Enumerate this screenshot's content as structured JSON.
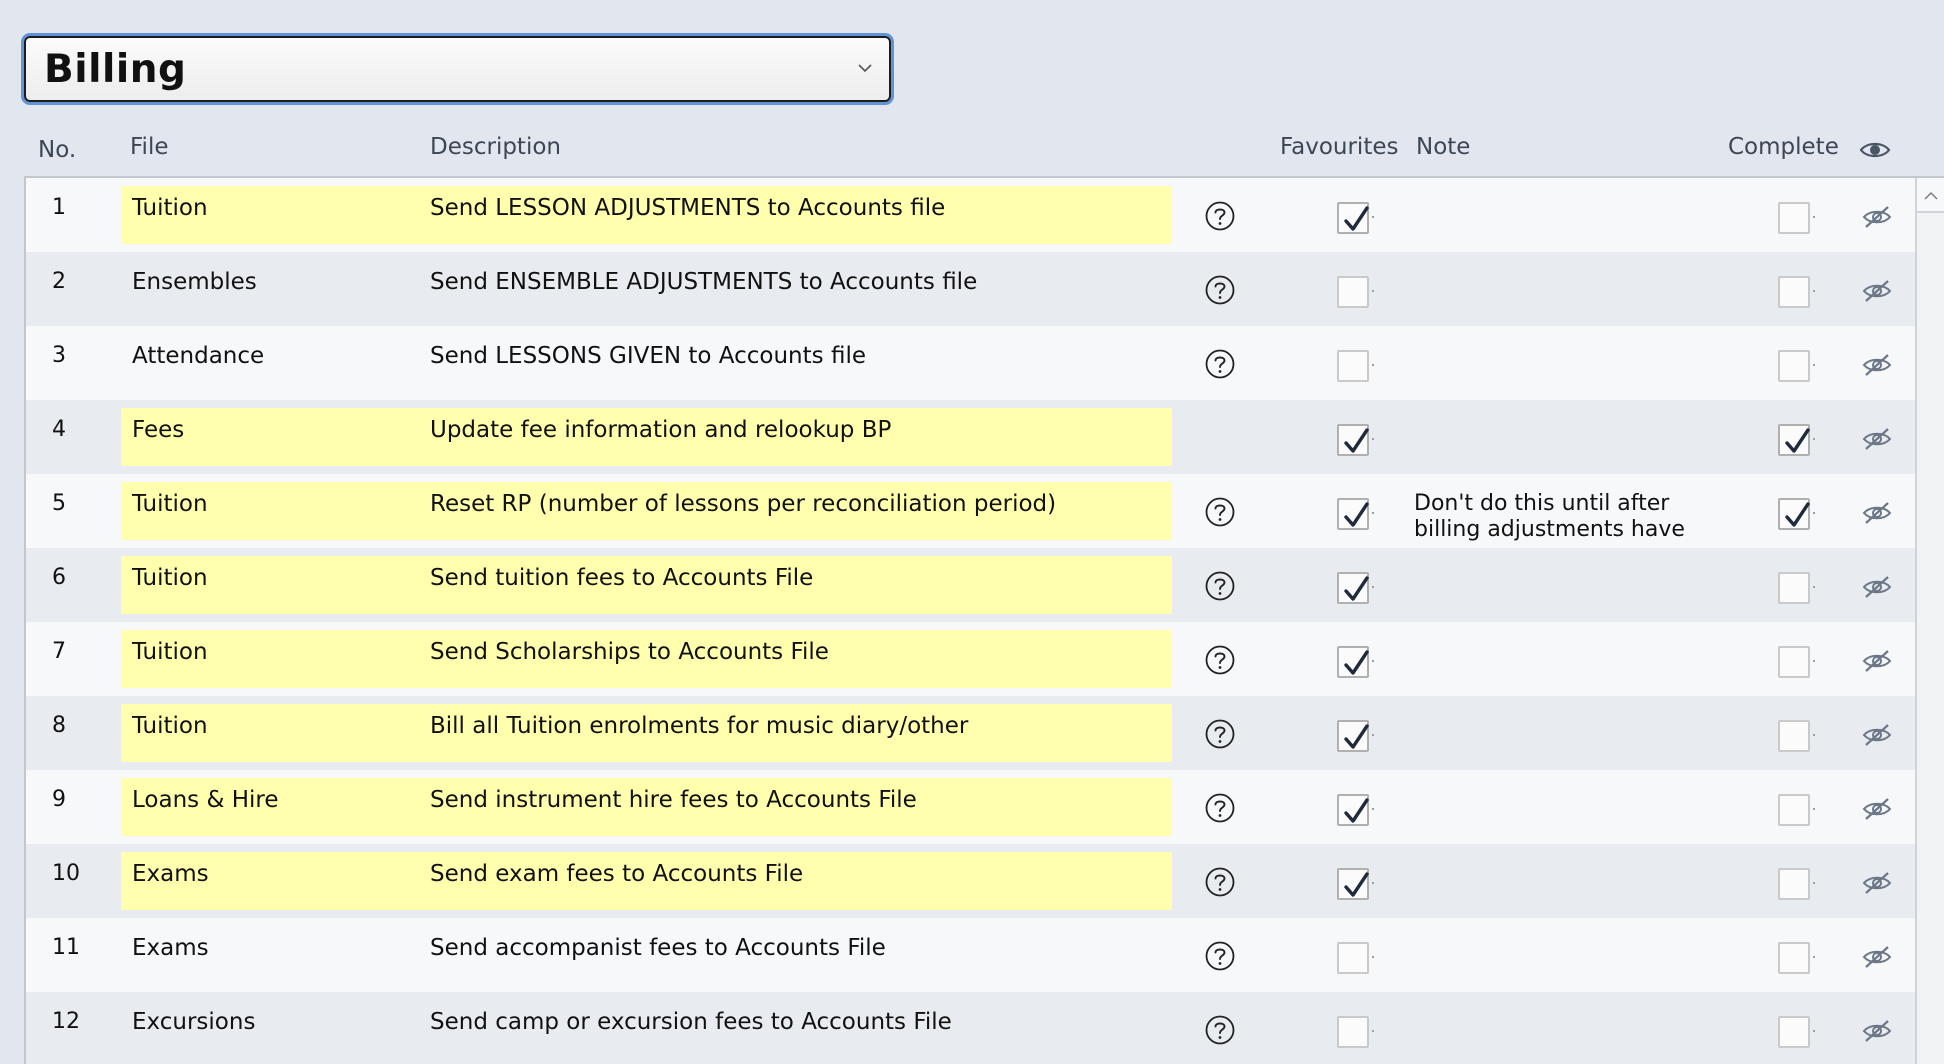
{
  "category_select": {
    "value": "Billing"
  },
  "columns": {
    "no": "No.",
    "file": "File",
    "description": "Description",
    "favourites": "Favourites",
    "note": "Note",
    "complete": "Complete"
  },
  "icons": {
    "dropdown": "chevron-down-icon",
    "help": "question-circle-icon",
    "visibility_header": "eye-icon",
    "row_visibility": "eye-slash-icon",
    "check": "checkmark-icon",
    "scroll_up": "caret-up-icon"
  },
  "colors": {
    "highlight": "#ffffad",
    "focus_ring": "#5f95d6",
    "check": "#1f2a3c"
  },
  "rows": [
    {
      "no": "1",
      "file": "Tuition",
      "description": "Send LESSON ADJUSTMENTS to Accounts file",
      "highlighted": true,
      "help": true,
      "favourite": true,
      "note": "",
      "complete": false
    },
    {
      "no": "2",
      "file": "Ensembles",
      "description": "Send ENSEMBLE ADJUSTMENTS to Accounts file",
      "highlighted": false,
      "help": true,
      "favourite": false,
      "note": "",
      "complete": false
    },
    {
      "no": "3",
      "file": "Attendance",
      "description": "Send LESSONS GIVEN to Accounts file",
      "highlighted": false,
      "help": true,
      "favourite": false,
      "note": "",
      "complete": false
    },
    {
      "no": "4",
      "file": "Fees",
      "description": "Update fee information and relookup BP",
      "highlighted": true,
      "help": false,
      "favourite": true,
      "note": "",
      "complete": true
    },
    {
      "no": "5",
      "file": "Tuition",
      "description": "Reset RP (number of lessons per reconciliation period)",
      "highlighted": true,
      "help": true,
      "favourite": true,
      "note": "Don't do this until after billing adjustments have",
      "complete": true
    },
    {
      "no": "6",
      "file": "Tuition",
      "description": "Send tuition fees to Accounts File",
      "highlighted": true,
      "help": true,
      "favourite": true,
      "note": "",
      "complete": false
    },
    {
      "no": "7",
      "file": "Tuition",
      "description": "Send Scholarships to Accounts File",
      "highlighted": true,
      "help": true,
      "favourite": true,
      "note": "",
      "complete": false
    },
    {
      "no": "8",
      "file": "Tuition",
      "description": "Bill all Tuition enrolments for music diary/other",
      "highlighted": true,
      "help": true,
      "favourite": true,
      "note": "",
      "complete": false
    },
    {
      "no": "9",
      "file": "Loans & Hire",
      "description": "Send instrument hire fees to Accounts File",
      "highlighted": true,
      "help": true,
      "favourite": true,
      "note": "",
      "complete": false
    },
    {
      "no": "10",
      "file": "Exams",
      "description": "Send exam fees to Accounts File",
      "highlighted": true,
      "help": true,
      "favourite": true,
      "note": "",
      "complete": false
    },
    {
      "no": "11",
      "file": "Exams",
      "description": "Send accompanist fees to Accounts File",
      "highlighted": false,
      "help": true,
      "favourite": false,
      "note": "",
      "complete": false
    },
    {
      "no": "12",
      "file": "Excursions",
      "description": "Send camp or excursion fees to Accounts File",
      "highlighted": false,
      "help": true,
      "favourite": false,
      "note": "",
      "complete": false
    }
  ]
}
